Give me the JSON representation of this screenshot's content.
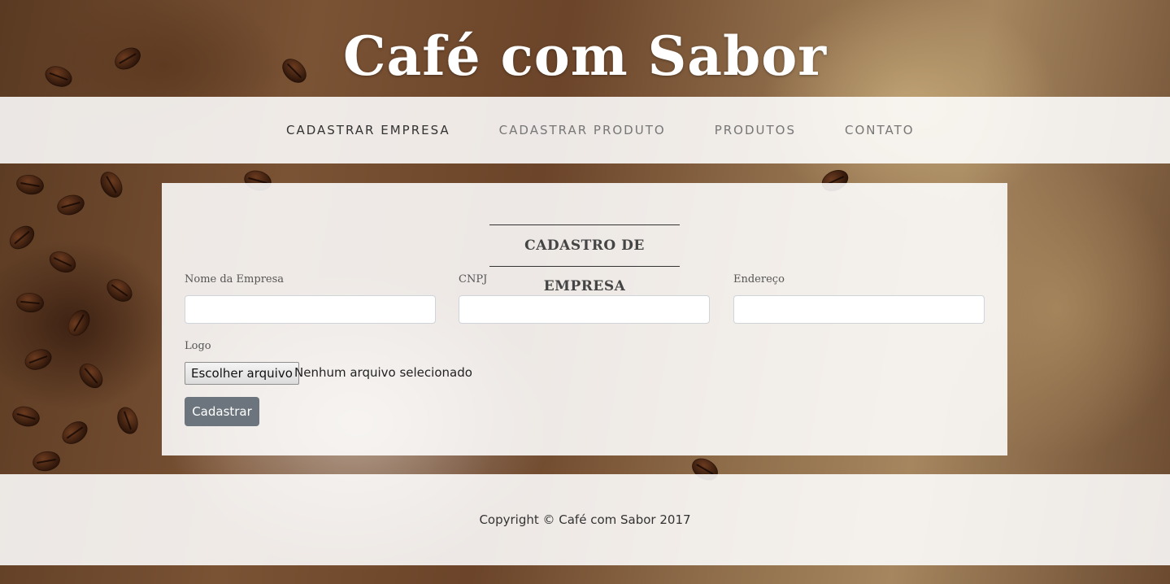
{
  "header": {
    "title": "Café com Sabor"
  },
  "nav": {
    "items": [
      {
        "label": "CADASTRAR EMPRESA",
        "active": true
      },
      {
        "label": "CADASTRAR PRODUTO",
        "active": false
      },
      {
        "label": "PRODUTOS",
        "active": false
      },
      {
        "label": "CONTATO",
        "active": false
      }
    ]
  },
  "form": {
    "title": "CADASTRO DE EMPRESA",
    "fields": {
      "name": {
        "label": "Nome da Empresa",
        "value": "",
        "placeholder": ""
      },
      "cnpj": {
        "label": "CNPJ",
        "value": "",
        "placeholder": ""
      },
      "address": {
        "label": "Endereço",
        "value": "",
        "placeholder": ""
      }
    },
    "logo": {
      "label": "Logo",
      "button_label": "Escolher arquivo",
      "status": "Nenhum arquivo selecionado"
    },
    "submit_label": "Cadastrar"
  },
  "footer": {
    "copyright": "Copyright © Café com Sabor 2017"
  },
  "colors": {
    "submit_button": "#6c757d",
    "nav_active": "#333333",
    "nav_inactive": "#777777"
  }
}
